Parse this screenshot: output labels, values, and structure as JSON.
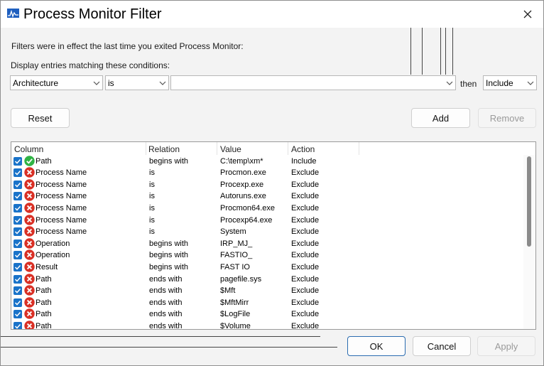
{
  "window": {
    "title": "Process Monitor Filter"
  },
  "labels": {
    "filters_note": "Filters were in effect the last time you exited Process Monitor:",
    "display_entries": "Display entries matching these conditions:",
    "then": "then"
  },
  "condition": {
    "column_value": "Architecture",
    "relation_value": "is",
    "value_value": "",
    "action_value": "Include"
  },
  "buttons": {
    "reset": "Reset",
    "add": "Add",
    "remove": "Remove",
    "ok": "OK",
    "cancel": "Cancel",
    "apply": "Apply"
  },
  "table": {
    "headers": [
      "Column",
      "Relation",
      "Value",
      "Action"
    ],
    "rows": [
      {
        "column": "Path",
        "relation": "begins with",
        "value": "C:\\temp\\xm*",
        "action": "Include",
        "type": "include"
      },
      {
        "column": "Process Name",
        "relation": "is",
        "value": "Procmon.exe",
        "action": "Exclude",
        "type": "exclude"
      },
      {
        "column": "Process Name",
        "relation": "is",
        "value": "Procexp.exe",
        "action": "Exclude",
        "type": "exclude"
      },
      {
        "column": "Process Name",
        "relation": "is",
        "value": "Autoruns.exe",
        "action": "Exclude",
        "type": "exclude"
      },
      {
        "column": "Process Name",
        "relation": "is",
        "value": "Procmon64.exe",
        "action": "Exclude",
        "type": "exclude"
      },
      {
        "column": "Process Name",
        "relation": "is",
        "value": "Procexp64.exe",
        "action": "Exclude",
        "type": "exclude"
      },
      {
        "column": "Process Name",
        "relation": "is",
        "value": "System",
        "action": "Exclude",
        "type": "exclude"
      },
      {
        "column": "Operation",
        "relation": "begins with",
        "value": "IRP_MJ_",
        "action": "Exclude",
        "type": "exclude"
      },
      {
        "column": "Operation",
        "relation": "begins with",
        "value": "FASTIO_",
        "action": "Exclude",
        "type": "exclude"
      },
      {
        "column": "Result",
        "relation": "begins with",
        "value": "FAST IO",
        "action": "Exclude",
        "type": "exclude"
      },
      {
        "column": "Path",
        "relation": "ends with",
        "value": "pagefile.sys",
        "action": "Exclude",
        "type": "exclude"
      },
      {
        "column": "Path",
        "relation": "ends with",
        "value": "$Mft",
        "action": "Exclude",
        "type": "exclude"
      },
      {
        "column": "Path",
        "relation": "ends with",
        "value": "$MftMirr",
        "action": "Exclude",
        "type": "exclude"
      },
      {
        "column": "Path",
        "relation": "ends with",
        "value": "$LogFile",
        "action": "Exclude",
        "type": "exclude"
      },
      {
        "column": "Path",
        "relation": "ends with",
        "value": "$Volume",
        "action": "Exclude",
        "type": "exclude"
      }
    ]
  },
  "colors": {
    "include": "#2fb344",
    "exclude": "#d93025",
    "checkbox": "#1a73c9",
    "ok_border": "#2b6cb0"
  }
}
